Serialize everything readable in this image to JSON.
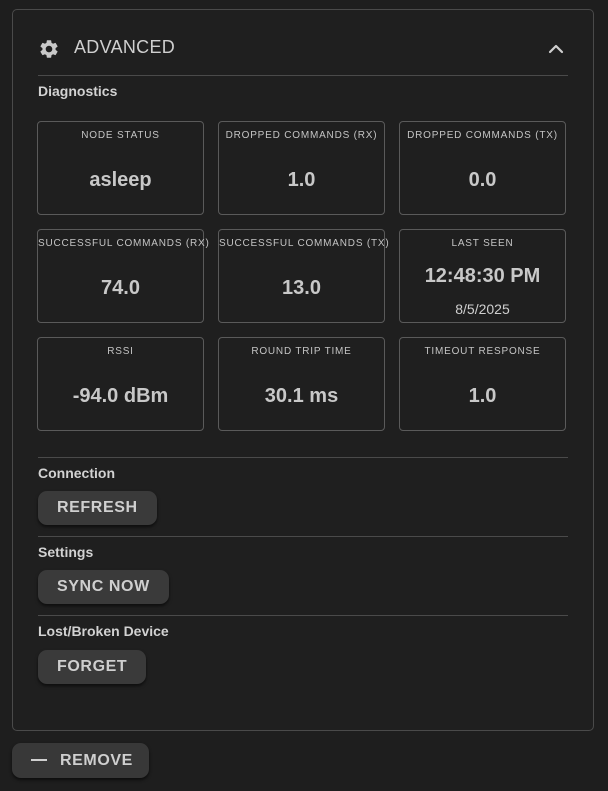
{
  "header": {
    "title": "ADVANCED",
    "icon": "gear-icon",
    "toggle_icon": "chevron-up-icon"
  },
  "diagnostics": {
    "label": "Diagnostics",
    "tiles": [
      {
        "label": "NODE STATUS",
        "value": "asleep"
      },
      {
        "label": "DROPPED COMMANDS (RX)",
        "value": "1.0"
      },
      {
        "label": "DROPPED COMMANDS (TX)",
        "value": "0.0"
      },
      {
        "label": "SUCCESSFUL COMMANDS (RX)",
        "value": "74.0"
      },
      {
        "label": "SUCCESSFUL COMMANDS (TX)",
        "value": "13.0"
      },
      {
        "label": "LAST SEEN",
        "value": "12:48:30 PM",
        "sub": "8/5/2025"
      },
      {
        "label": "RSSI",
        "value": "-94.0 dBm"
      },
      {
        "label": "ROUND TRIP TIME",
        "value": "30.1 ms"
      },
      {
        "label": "TIMEOUT RESPONSE",
        "value": "1.0"
      }
    ]
  },
  "connection": {
    "label": "Connection",
    "button": "REFRESH"
  },
  "settings": {
    "label": "Settings",
    "button": "SYNC NOW"
  },
  "lost_device": {
    "label": "Lost/Broken Device",
    "button": "FORGET"
  },
  "remove": {
    "label": "REMOVE",
    "icon": "minus-icon"
  },
  "colors": {
    "background": "#1e1e1e",
    "border": "#4a4a4a",
    "button": "#3a3a3a",
    "text": "#cfcfcf"
  }
}
